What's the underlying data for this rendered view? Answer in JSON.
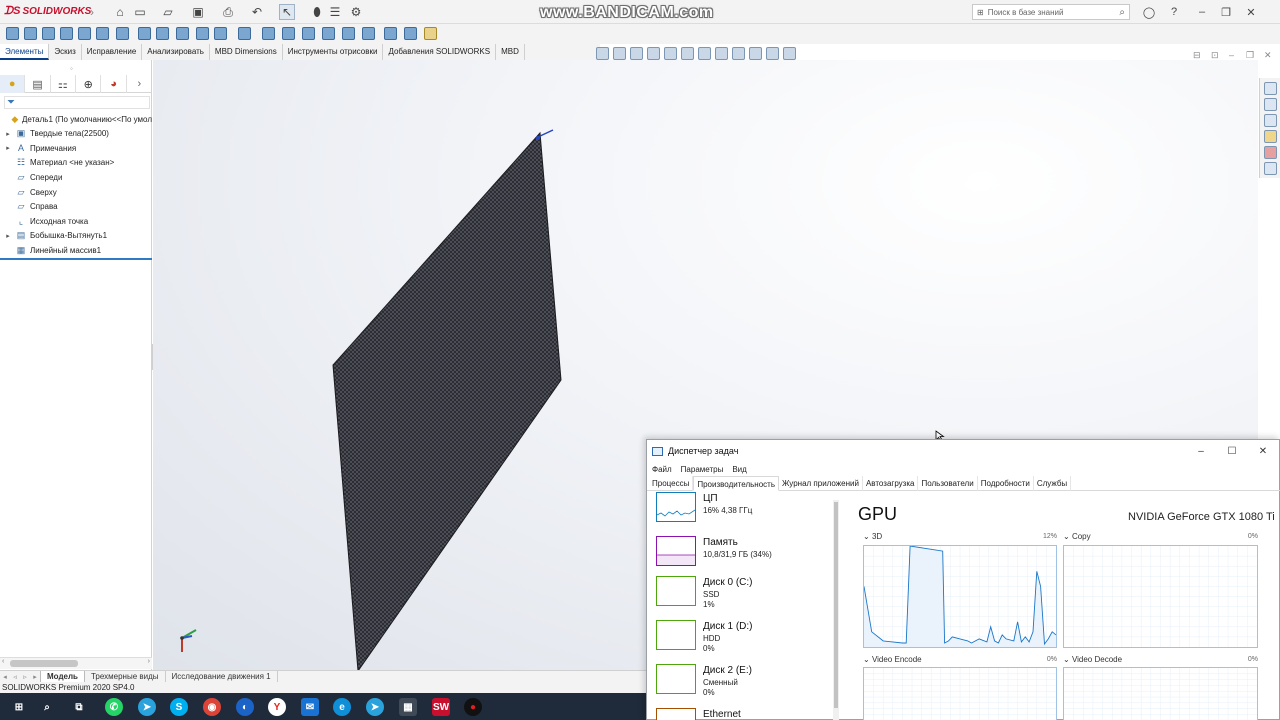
{
  "app": {
    "brand": "SOLIDWORKS",
    "search_placeholder": "Поиск в базе знаний",
    "watermark": "www.BANDICAM.com"
  },
  "command_tabs": [
    {
      "label": "Элементы",
      "active": true
    },
    {
      "label": "Эскиз",
      "active": false
    },
    {
      "label": "Исправление",
      "active": false
    },
    {
      "label": "Анализировать",
      "active": false
    },
    {
      "label": "MBD Dimensions",
      "active": false
    },
    {
      "label": "Инструменты отрисовки",
      "active": false
    },
    {
      "label": "Добавления SOLIDWORKS",
      "active": false
    },
    {
      "label": "MBD",
      "active": false
    }
  ],
  "feature_tree": {
    "items": [
      {
        "label": "Деталь1  (По умолчанию<<По умол",
        "icon": "part-icon",
        "expand": "",
        "indent": 0
      },
      {
        "label": "Твердые тела(22500)",
        "icon": "solid-bodies-icon",
        "expand": "▸",
        "indent": 1
      },
      {
        "label": "Примечания",
        "icon": "annotations-icon",
        "expand": "▸",
        "indent": 1
      },
      {
        "label": "Материал <не указан>",
        "icon": "material-icon",
        "expand": "",
        "indent": 1
      },
      {
        "label": "Спереди",
        "icon": "plane-icon",
        "expand": "",
        "indent": 1
      },
      {
        "label": "Сверху",
        "icon": "plane-icon",
        "expand": "",
        "indent": 1
      },
      {
        "label": "Справа",
        "icon": "plane-icon",
        "expand": "",
        "indent": 1
      },
      {
        "label": "Исходная точка",
        "icon": "origin-icon",
        "expand": "",
        "indent": 1
      },
      {
        "label": "Бобышка-Вытянуть1",
        "icon": "extrude-icon",
        "expand": "▸",
        "indent": 1
      },
      {
        "label": "Линейный массив1",
        "icon": "linear-pattern-icon",
        "expand": "",
        "indent": 1
      }
    ]
  },
  "bottom_tabs": [
    {
      "label": "Модель",
      "active": true
    },
    {
      "label": "Трехмерные виды",
      "active": false
    },
    {
      "label": "Исследование движения 1",
      "active": false
    }
  ],
  "status": "SOLIDWORKS Premium 2020 SP4.0",
  "task_manager": {
    "title": "Диспетчер задач",
    "menu": [
      "Файл",
      "Параметры",
      "Вид"
    ],
    "tabs": [
      {
        "label": "Процессы",
        "active": false
      },
      {
        "label": "Производительность",
        "active": true
      },
      {
        "label": "Журнал приложений",
        "active": false
      },
      {
        "label": "Автозагрузка",
        "active": false
      },
      {
        "label": "Пользователи",
        "active": false
      },
      {
        "label": "Подробности",
        "active": false
      },
      {
        "label": "Службы",
        "active": false
      }
    ],
    "resources": [
      {
        "name": "ЦП",
        "line2": "16% 4,38 ГГц",
        "line3": "",
        "color": "#117dbb"
      },
      {
        "name": "Память",
        "line2": "10,8/31,9 ГБ (34%)",
        "line3": "",
        "color": "#8b12ae"
      },
      {
        "name": "Диск 0 (C:)",
        "line2": "SSD",
        "line3": "1%",
        "color": "#4da60c"
      },
      {
        "name": "Диск 1 (D:)",
        "line2": "HDD",
        "line3": "0%",
        "color": "#4da60c"
      },
      {
        "name": "Диск 2 (E:)",
        "line2": "Сменный",
        "line3": "0%",
        "color": "#4da60c"
      },
      {
        "name": "Ethernet",
        "line2": "",
        "line3": "",
        "color": "#a74f01"
      }
    ],
    "gpu": {
      "title": "GPU",
      "model": "NVIDIA GeForce GTX 1080 Ti",
      "engines": [
        {
          "label": "3D",
          "percent": "12%",
          "level": 12
        },
        {
          "label": "Copy",
          "percent": "0%",
          "level": 0
        },
        {
          "label": "Video Encode",
          "percent": "0%",
          "level": 0
        },
        {
          "label": "Video Decode",
          "percent": "0%",
          "level": 0
        }
      ]
    }
  },
  "taskbar_icons": [
    "windows-start-icon",
    "search-icon",
    "task-view-icon",
    "whatsapp-icon",
    "telegram-icon",
    "skype-icon",
    "chrome-icon",
    "firefox-icon",
    "yandex-browser-icon",
    "mail-icon",
    "edge-icon",
    "telegram-icon",
    "task-manager-icon",
    "solidworks-icon",
    "bandicam-icon"
  ]
}
